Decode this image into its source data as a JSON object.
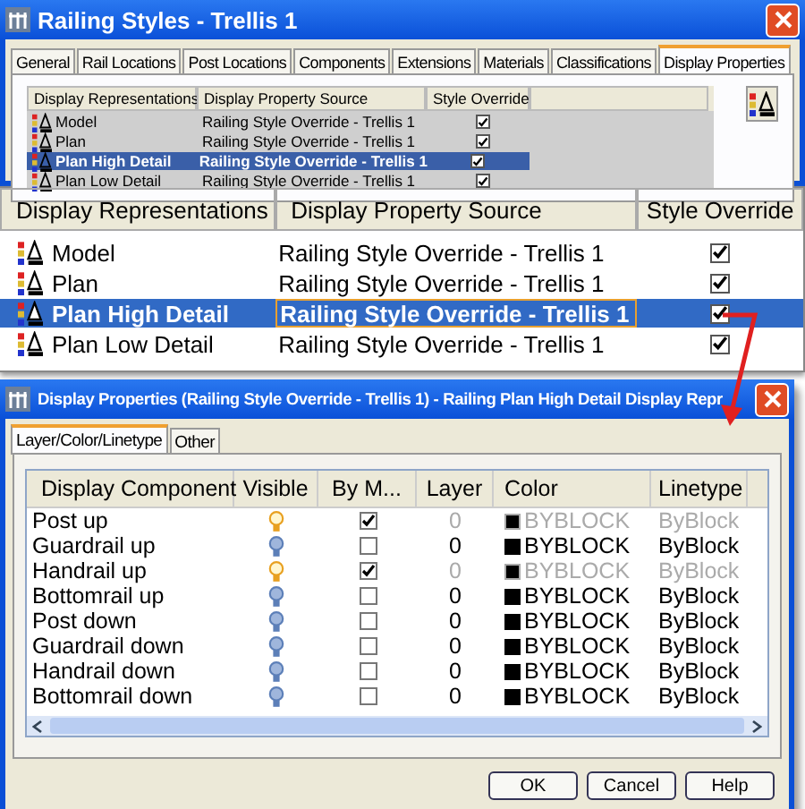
{
  "window": {
    "title": "Railing Styles - Trellis 1"
  },
  "tabs": [
    {
      "label": "General",
      "selected": false
    },
    {
      "label": "Rail Locations",
      "selected": false
    },
    {
      "label": "Post Locations",
      "selected": false
    },
    {
      "label": "Components",
      "selected": false
    },
    {
      "label": "Extensions",
      "selected": false
    },
    {
      "label": "Materials",
      "selected": false
    },
    {
      "label": "Classifications",
      "selected": false
    },
    {
      "label": "Display Properties",
      "selected": true
    }
  ],
  "display_table": {
    "columns": [
      "Display Representations",
      "Display Property Source",
      "Style Override"
    ],
    "rows": [
      {
        "name": "Model",
        "source": "Railing Style Override - Trellis 1",
        "override": true,
        "selected": false
      },
      {
        "name": "Plan",
        "source": "Railing Style Override - Trellis 1",
        "override": true,
        "selected": false
      },
      {
        "name": "Plan High Detail",
        "source": "Railing Style Override - Trellis 1",
        "override": true,
        "selected": true
      },
      {
        "name": "Plan Low Detail",
        "source": "Railing Style Override - Trellis 1",
        "override": true,
        "selected": false
      }
    ]
  },
  "zoom_inset": {
    "columns": [
      "Display Representations",
      "Display Property Source",
      "Style Override"
    ],
    "rows": [
      {
        "name": "Model",
        "source": "Railing Style Override - Trellis 1",
        "override": true,
        "selected": false
      },
      {
        "name": "Plan",
        "source": "Railing Style Override - Trellis 1",
        "override": true,
        "selected": false
      },
      {
        "name": "Plan High Detail",
        "source": "Railing Style Override - Trellis 1",
        "override": true,
        "selected": true
      },
      {
        "name": "Plan Low Detail",
        "source": "Railing Style Override - Trellis 1",
        "override": true,
        "selected": false
      }
    ]
  },
  "properties_dialog": {
    "title": "Display Properties (Railing Style Override - Trellis 1) - Railing Plan High Detail Display Repr",
    "tabs": [
      {
        "label": "Layer/Color/Linetype",
        "selected": true
      },
      {
        "label": "Other",
        "selected": false
      }
    ],
    "columns": [
      "Display Component",
      "Visible",
      "By M...",
      "Layer",
      "Color",
      "Linetype"
    ],
    "rows": [
      {
        "component": "Post up",
        "visible": true,
        "by_material": true,
        "layer": "0",
        "color_name": "BYBLOCK",
        "linetype": "ByBlock"
      },
      {
        "component": "Guardrail up",
        "visible": false,
        "by_material": false,
        "layer": "0",
        "color_name": "BYBLOCK",
        "linetype": "ByBlock"
      },
      {
        "component": "Handrail up",
        "visible": true,
        "by_material": true,
        "layer": "0",
        "color_name": "BYBLOCK",
        "linetype": "ByBlock"
      },
      {
        "component": "Bottomrail up",
        "visible": false,
        "by_material": false,
        "layer": "0",
        "color_name": "BYBLOCK",
        "linetype": "ByBlock"
      },
      {
        "component": "Post down",
        "visible": false,
        "by_material": false,
        "layer": "0",
        "color_name": "BYBLOCK",
        "linetype": "ByBlock"
      },
      {
        "component": "Guardrail down",
        "visible": false,
        "by_material": false,
        "layer": "0",
        "color_name": "BYBLOCK",
        "linetype": "ByBlock"
      },
      {
        "component": "Handrail down",
        "visible": false,
        "by_material": false,
        "layer": "0",
        "color_name": "BYBLOCK",
        "linetype": "ByBlock"
      },
      {
        "component": "Bottomrail down",
        "visible": false,
        "by_material": false,
        "layer": "0",
        "color_name": "BYBLOCK",
        "linetype": "ByBlock"
      }
    ],
    "buttons": [
      "OK",
      "Cancel",
      "Help"
    ]
  }
}
